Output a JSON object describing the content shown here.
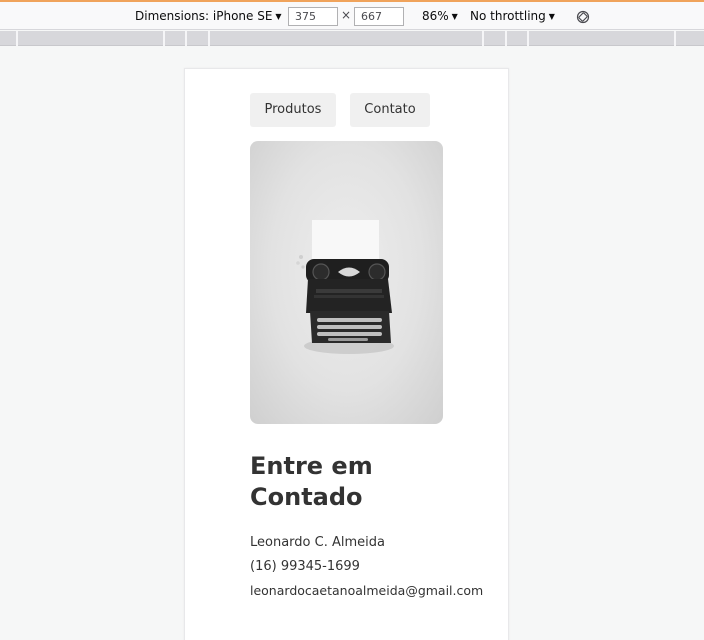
{
  "devtools": {
    "dimensions_label": "Dimensions: iPhone SE",
    "width": "375",
    "times": "×",
    "height": "667",
    "zoom": "86%",
    "throttling": "No throttling",
    "rotate_icon": "rotate-icon",
    "accent_color": "#f0a35b"
  },
  "nav": {
    "items": [
      {
        "label": "Produtos"
      },
      {
        "label": "Contato"
      }
    ]
  },
  "hero": {
    "image": "typewriter-photo"
  },
  "contact": {
    "heading": "Entre em Contado",
    "name": "Leonardo C. Almeida",
    "phone": "(16) 99345-1699",
    "email": "leonardocaetanoalmeida@gmail.com"
  }
}
